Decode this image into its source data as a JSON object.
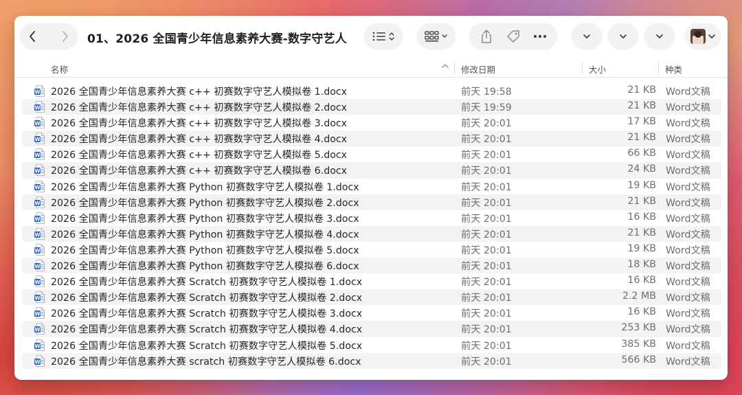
{
  "window": {
    "title": "01、2026 全国青少年信息素养大赛-数字守艺人"
  },
  "columns": {
    "name": "名称",
    "modified": "修改日期",
    "size": "大小",
    "kind": "种类"
  },
  "files": [
    {
      "name": "2026 全国青少年信息素养大赛 c++ 初赛数字守艺人模拟卷 1.docx",
      "modified": "前天 19:58",
      "size": "21 KB",
      "kind": "Word文稿"
    },
    {
      "name": "2026 全国青少年信息素养大赛 c++ 初赛数字守艺人模拟卷 2.docx",
      "modified": "前天 19:59",
      "size": "21 KB",
      "kind": "Word文稿"
    },
    {
      "name": "2026 全国青少年信息素养大赛 c++ 初赛数字守艺人模拟卷 3.docx",
      "modified": "前天 20:01",
      "size": "17 KB",
      "kind": "Word文稿"
    },
    {
      "name": "2026 全国青少年信息素养大赛 c++ 初赛数字守艺人模拟卷 4.docx",
      "modified": "前天 20:01",
      "size": "21 KB",
      "kind": "Word文稿"
    },
    {
      "name": "2026 全国青少年信息素养大赛 c++ 初赛数字守艺人模拟卷 5.docx",
      "modified": "前天 20:01",
      "size": "66 KB",
      "kind": "Word文稿"
    },
    {
      "name": "2026 全国青少年信息素养大赛 c++ 初赛数字守艺人模拟卷 6.docx",
      "modified": "前天 20:01",
      "size": "24 KB",
      "kind": "Word文稿"
    },
    {
      "name": "2026 全国青少年信息素养大赛 Python 初赛数字守艺人模拟卷 1.docx",
      "modified": "前天 20:01",
      "size": "19 KB",
      "kind": "Word文稿"
    },
    {
      "name": "2026 全国青少年信息素养大赛 Python 初赛数字守艺人模拟卷 2.docx",
      "modified": "前天 20:01",
      "size": "21 KB",
      "kind": "Word文稿"
    },
    {
      "name": "2026 全国青少年信息素养大赛 Python 初赛数字守艺人模拟卷 3.docx",
      "modified": "前天 20:01",
      "size": "16 KB",
      "kind": "Word文稿"
    },
    {
      "name": "2026 全国青少年信息素养大赛 Python 初赛数字守艺人模拟卷 4.docx",
      "modified": "前天 20:01",
      "size": "21 KB",
      "kind": "Word文稿"
    },
    {
      "name": "2026 全国青少年信息素养大赛 Python 初赛数字守艺人模拟卷 5.docx",
      "modified": "前天 20:01",
      "size": "19 KB",
      "kind": "Word文稿"
    },
    {
      "name": "2026 全国青少年信息素养大赛 Python 初赛数字守艺人模拟卷 6.docx",
      "modified": "前天 20:01",
      "size": "18 KB",
      "kind": "Word文稿"
    },
    {
      "name": "2026 全国青少年信息素养大赛 Scratch 初赛数字守艺人模拟卷 1.docx",
      "modified": "前天 20:01",
      "size": "16 KB",
      "kind": "Word文稿"
    },
    {
      "name": "2026 全国青少年信息素养大赛 Scratch 初赛数字守艺人模拟卷 2.docx",
      "modified": "前天 20:01",
      "size": "2.2 MB",
      "kind": "Word文稿"
    },
    {
      "name": "2026 全国青少年信息素养大赛 Scratch 初赛数字守艺人模拟卷 3.docx",
      "modified": "前天 20:01",
      "size": "16 KB",
      "kind": "Word文稿"
    },
    {
      "name": "2026 全国青少年信息素养大赛 Scratch 初赛数字守艺人模拟卷 4.docx",
      "modified": "前天 20:01",
      "size": "253 KB",
      "kind": "Word文稿"
    },
    {
      "name": "2026 全国青少年信息素养大赛 Scratch 初赛数字守艺人模拟卷 5.docx",
      "modified": "前天 20:01",
      "size": "385 KB",
      "kind": "Word文稿"
    },
    {
      "name": "2026 全国青少年信息素养大赛 scratch 初赛数字守艺人模拟卷 6.docx",
      "modified": "前天 20:01",
      "size": "566 KB",
      "kind": "Word文稿"
    }
  ],
  "icons": {
    "file": "word-document-icon",
    "file_color": "#2b5cb8"
  }
}
